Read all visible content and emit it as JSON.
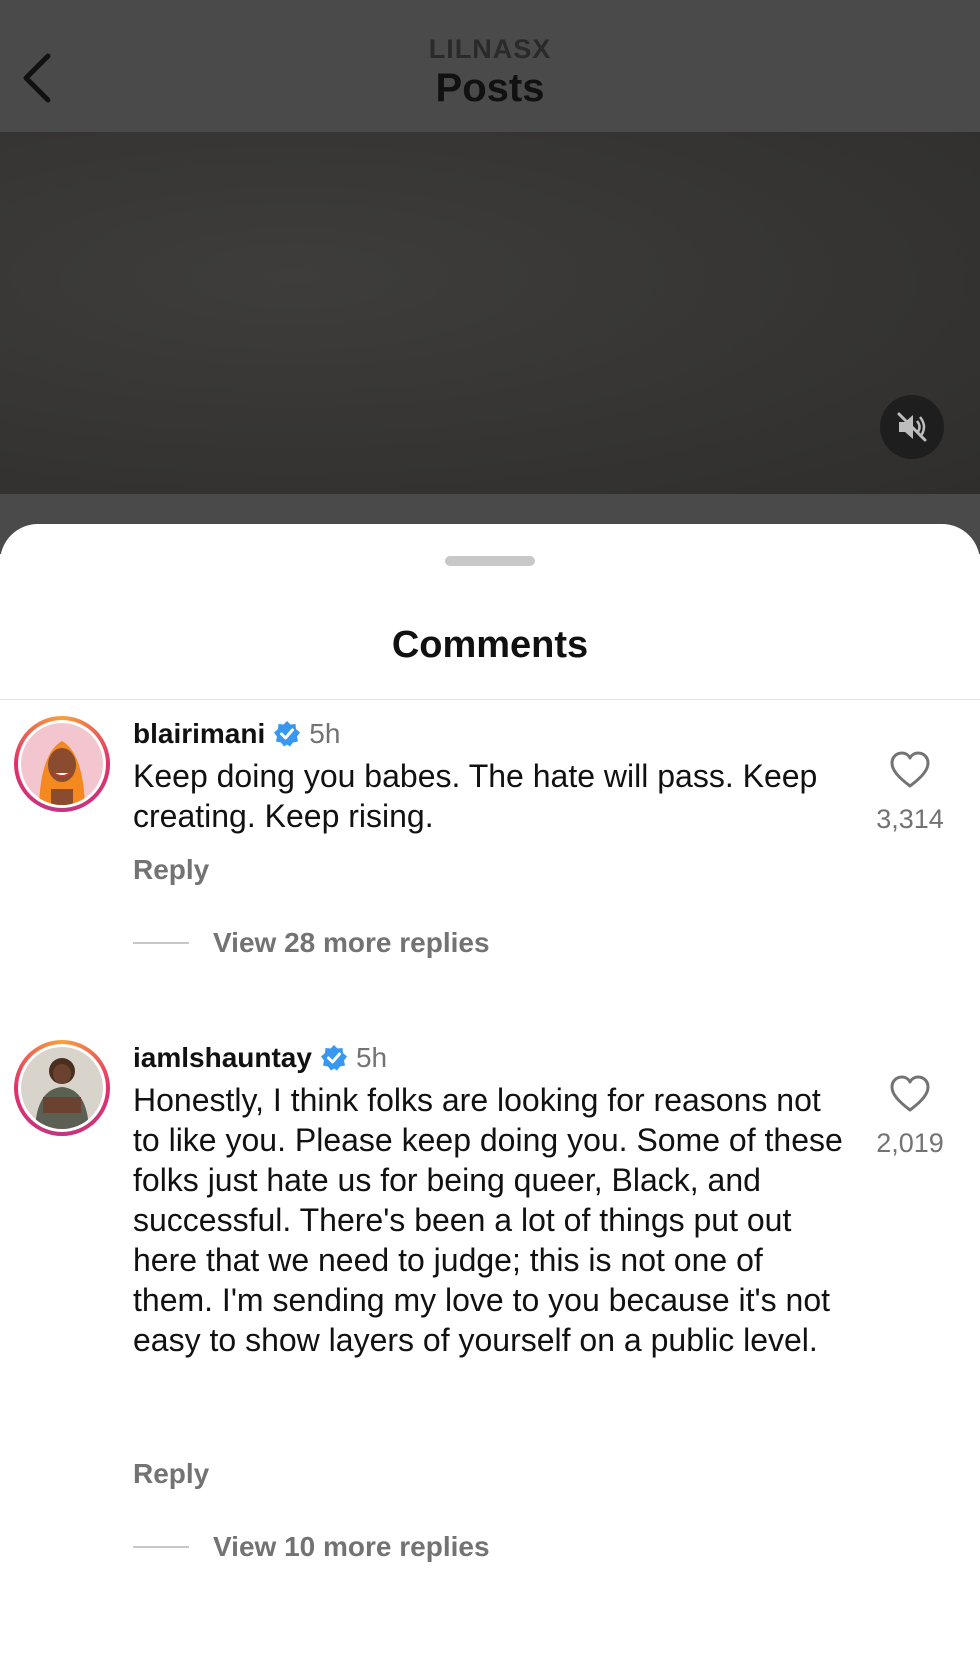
{
  "header": {
    "account": "LILNASX",
    "title": "Posts"
  },
  "sheet": {
    "title": "Comments"
  },
  "comments": [
    {
      "username": "blairimani",
      "verified": true,
      "time": "5h",
      "text": "Keep doing you babes. The hate will pass. Keep creating. Keep rising.",
      "reply_label": "Reply",
      "view_replies": "View 28 more replies",
      "likes": "3,314"
    },
    {
      "username": "iamlshauntay",
      "verified": true,
      "time": "5h",
      "text": "Honestly, I think folks are looking for reasons not to like you. Please keep doing you. Some of these folks just hate us for being queer, Black, and successful. There's been a lot of things put out here that we need to judge; this is not one of them. I'm sending my love to you because it's not easy to show layers of yourself on a public level.",
      "reply_label": "Reply",
      "view_replies": "View 10 more replies",
      "likes": "2,019"
    }
  ],
  "colors": {
    "verified_badge": "#3897f0",
    "secondary_text": "#737373"
  },
  "icons": {
    "back": "chevron-left-icon",
    "mute": "speaker-muted-icon",
    "like": "heart-outline-icon",
    "verified": "verified-badge-icon"
  }
}
